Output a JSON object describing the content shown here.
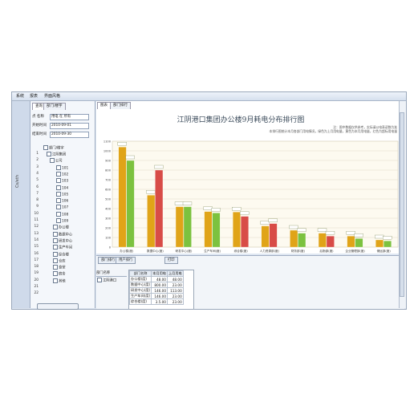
{
  "menubar": {
    "items": [
      "系统",
      "报表",
      "界面风格"
    ]
  },
  "left_strip": {
    "label": "Cs/eth"
  },
  "tree_panel": {
    "tabs": [
      "查询",
      "部门/楼宇"
    ],
    "form": [
      {
        "label": "点 名称",
        "value": "用电 在 所有"
      },
      {
        "label": "开始时间",
        "value": "2010-09-01"
      },
      {
        "label": "结束时间",
        "value": "2010-09-30"
      }
    ],
    "tree_header": "部门/楼宇",
    "row_numbers": [
      "1",
      "2",
      "3",
      "4",
      "5",
      "6",
      "7",
      "8",
      "9",
      "10",
      "11",
      "12",
      "13",
      "14",
      "15",
      "16",
      "17",
      "18",
      "19",
      "20",
      "21",
      "22"
    ],
    "tree_items": [
      "江阴集团",
      "公司",
      "101",
      "102",
      "103",
      "104",
      "105",
      "106",
      "107",
      "108",
      "109",
      "办公楼",
      "数据中心",
      "研发中心",
      "生产车间",
      "综合楼",
      "仓库",
      "食堂",
      "宿舍",
      "其他"
    ]
  },
  "chart_tabs": [
    "图表",
    "部门排行"
  ],
  "chart_data": {
    "type": "bar",
    "title": "江阴港口集团办公楼9月耗电分布排行图",
    "subtitle_lines": [
      "注：图中数据仅供参考，实际请以电表读数为准",
      "本排行图统计本月各部门用电情况，绿色为上月用电量，黄色为本月用电量，红色为超标用电量"
    ],
    "ylim": [
      0,
      1100
    ],
    "yticks": [
      0,
      100,
      200,
      300,
      400,
      500,
      600,
      700,
      800,
      900,
      1000,
      1100
    ],
    "categories": [
      "办公楼(度)",
      "数据中心(度)",
      "研发中心(度)",
      "生产车间(度)",
      "综合楼(度)",
      "人力资源部(度)",
      "财务部(度)",
      "后勤部(度)",
      "企业管理部(度)",
      "储运部(度)"
    ],
    "series": [
      {
        "color": "#e0a418",
        "values": [
          1040,
          540,
          420,
          370,
          365,
          220,
          175,
          145,
          115,
          75
        ]
      },
      {
        "color": "#7cc23f",
        "values": [
          900,
          null,
          420,
          355,
          null,
          null,
          145,
          null,
          90,
          65
        ]
      },
      {
        "color": "#d84c47",
        "values": [
          null,
          800,
          null,
          null,
          320,
          245,
          null,
          115,
          null,
          null
        ]
      }
    ]
  },
  "bottom": {
    "tabs": [
      "部门排行",
      "用户排行"
    ],
    "print_label": "打印",
    "list_header": "部门名称",
    "list_item": "江阴港口",
    "grid_headers": [
      "部门名称",
      "本月用电",
      "上月用电"
    ],
    "grid_rows": [
      [
        "办公楼(度)",
        "48.00",
        "48.00"
      ],
      [
        "数据中心(度)",
        "800.00",
        "23.00"
      ],
      [
        "研发中心(度)",
        "146.00",
        "113.00"
      ],
      [
        "生产车间(度)",
        "146.00",
        "23.00"
      ],
      [
        "综合楼(度)",
        "3.5.00",
        "23.00"
      ]
    ]
  }
}
